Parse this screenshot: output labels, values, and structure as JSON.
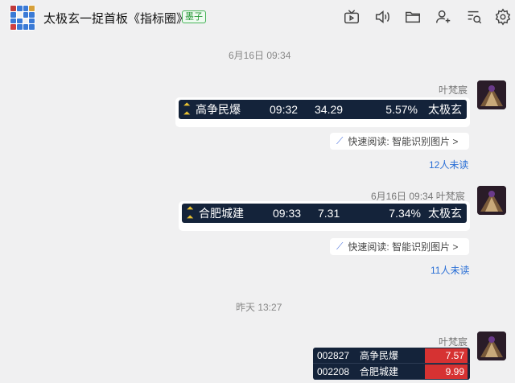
{
  "header": {
    "title": "太极玄一捉首板《指标圈》",
    "tag": "墨子",
    "tools": [
      "tv-icon",
      "mute-icon",
      "folder-icon",
      "add-member-icon",
      "chat-search-icon",
      "settings-icon"
    ]
  },
  "messages": [
    {
      "time_separator": "6月16日 09:34",
      "sender": "叶梵宸",
      "stock": {
        "name": "高争民爆",
        "time": "09:32",
        "price": "34.29",
        "change": "5.57%",
        "source": "太极玄"
      },
      "quick_read": "快速阅读: 智能识别图片 >",
      "unread": "12人未读"
    },
    {
      "time_separator": "",
      "sender": "6月16日 09:34 叶梵宸",
      "stock": {
        "name": "合肥城建",
        "time": "09:33",
        "price": "7.31",
        "change": "7.34%",
        "source": "太极玄"
      },
      "quick_read": "快速阅读: 智能识别图片 >",
      "unread": "11人未读"
    },
    {
      "time_separator": "昨天 13:27",
      "sender": "叶梵宸",
      "table": [
        {
          "code": "002827",
          "name": "高争民爆",
          "value": "7.57"
        },
        {
          "code": "002208",
          "name": "合肥城建",
          "value": "9.99"
        }
      ]
    }
  ],
  "colors": {
    "card_bg": "#14233a",
    "accent_up": "#e9c232",
    "link": "#2a6fd6",
    "red": "#d63232"
  }
}
